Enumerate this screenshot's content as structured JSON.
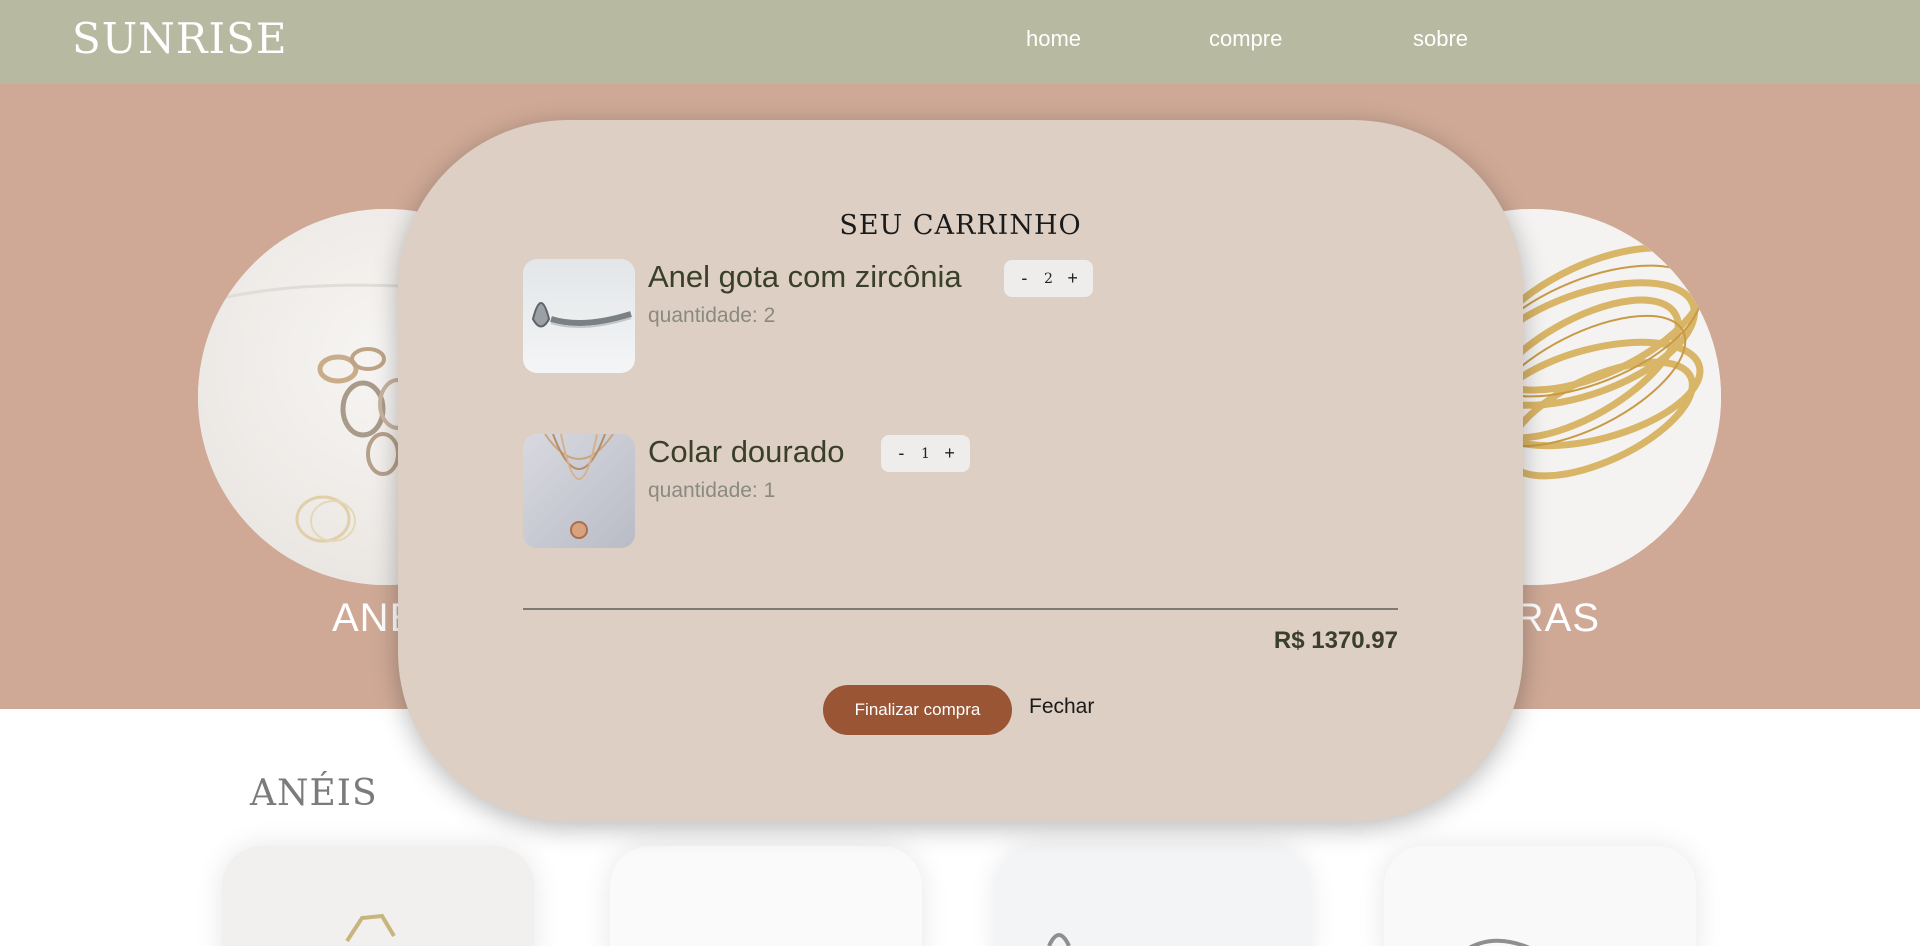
{
  "header": {
    "logo": "SUNRISE",
    "nav": {
      "home": "home",
      "compre": "compre",
      "sobre": "sobre"
    },
    "background": "#b7b9a0"
  },
  "hero": {
    "background": "#cfa996",
    "categories": {
      "left_label": "ANÉ",
      "right_label": "EIRAS"
    }
  },
  "section": {
    "title": "ANÉIS"
  },
  "cart": {
    "title": "SEU CARRINHO",
    "items": [
      {
        "name": "Anel gota com zircônia",
        "quantity_text": "quantidade: 2",
        "quantity": "2",
        "minus": "-",
        "plus": "+"
      },
      {
        "name": "Colar dourado",
        "quantity_text": "quantidade: 1",
        "quantity": "1",
        "minus": "-",
        "plus": "+"
      }
    ],
    "total": "R$ 1370.97",
    "checkout_label": "Finalizar compra",
    "close_label": "Fechar",
    "background": "#ddcfc3",
    "accent": "#9a5535"
  }
}
